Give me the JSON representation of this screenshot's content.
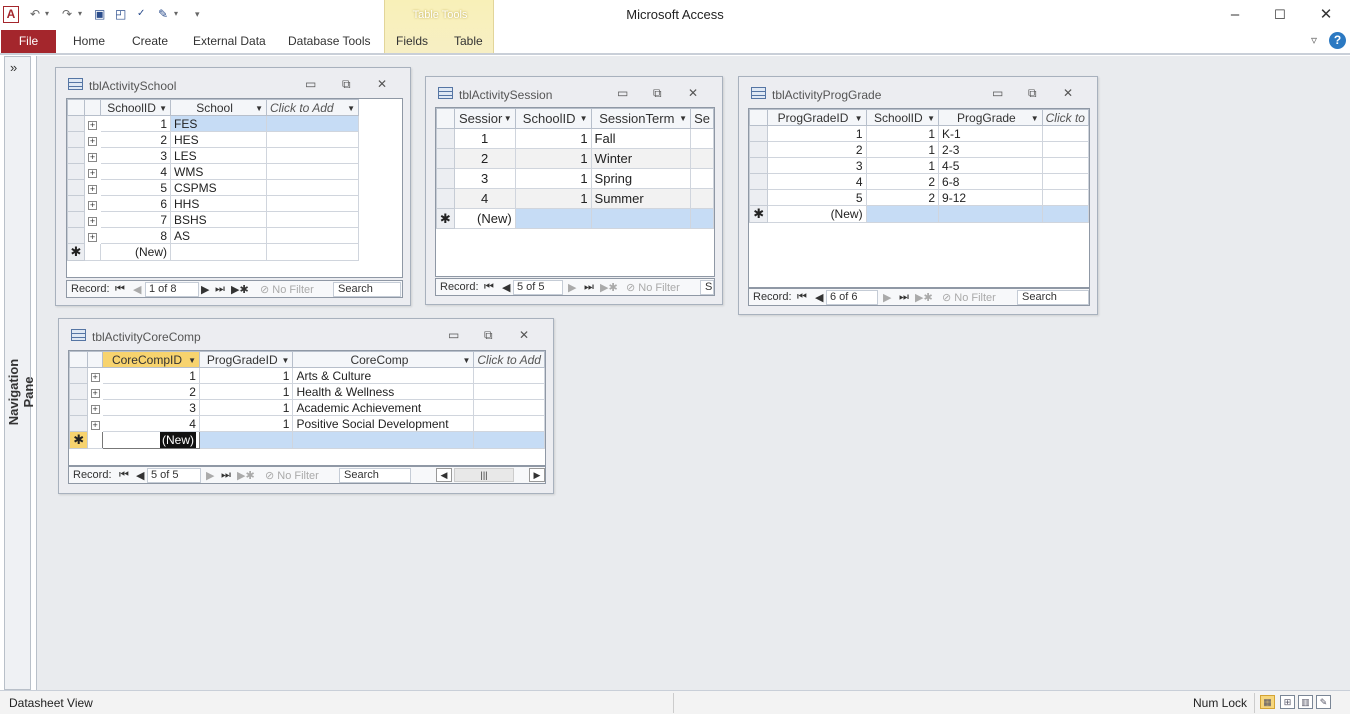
{
  "window_title": "Microsoft Access",
  "app_icon": "A",
  "contextual_tab": "Table Tools",
  "ribbon_tabs": [
    "File",
    "Home",
    "Create",
    "External Data",
    "Database Tools",
    "Fields",
    "Table"
  ],
  "nav_pane": {
    "label": "Navigation Pane",
    "toggle": "»"
  },
  "status": {
    "left": "Datasheet View",
    "numlock": "Num Lock"
  },
  "windows": {
    "school": {
      "title": "tblActivitySchool",
      "headers": [
        "SchoolID",
        "School",
        "Click to Add"
      ],
      "rows": [
        [
          "1",
          "FES"
        ],
        [
          "2",
          "HES"
        ],
        [
          "3",
          "LES"
        ],
        [
          "4",
          "WMS"
        ],
        [
          "5",
          "CSPMS"
        ],
        [
          "6",
          "HHS"
        ],
        [
          "7",
          "BSHS"
        ],
        [
          "8",
          "AS"
        ]
      ],
      "new_label": "(New)",
      "nav": {
        "record_label": "Record:",
        "position": "1 of 8",
        "filter": "No Filter",
        "search": "Search"
      }
    },
    "session": {
      "title": "tblActivitySession",
      "headers": [
        "Sessior",
        "SchoolID",
        "SessionTerm",
        "Se"
      ],
      "rows": [
        [
          "1",
          "1",
          "Fall"
        ],
        [
          "2",
          "1",
          "Winter"
        ],
        [
          "3",
          "1",
          "Spring"
        ],
        [
          "4",
          "1",
          "Summer"
        ]
      ],
      "new_label": "(New)",
      "nav": {
        "record_label": "Record:",
        "position": "5 of 5",
        "filter": "No Filter",
        "search": "S"
      }
    },
    "proggrade": {
      "title": "tblActivityProgGrade",
      "headers": [
        "ProgGradeID",
        "SchoolID",
        "ProgGrade",
        "Click to"
      ],
      "rows": [
        [
          "1",
          "1",
          "K-1"
        ],
        [
          "2",
          "1",
          "2-3"
        ],
        [
          "3",
          "1",
          "4-5"
        ],
        [
          "4",
          "2",
          "6-8"
        ],
        [
          "5",
          "2",
          "9-12"
        ]
      ],
      "new_label": "(New)",
      "nav": {
        "record_label": "Record:",
        "position": "6 of 6",
        "filter": "No Filter",
        "search": "Search"
      }
    },
    "corecomp": {
      "title": "tblActivityCoreComp",
      "headers": [
        "CoreCompID",
        "ProgGradeID",
        "CoreComp",
        "Click to Add"
      ],
      "rows": [
        [
          "1",
          "1",
          "Arts & Culture"
        ],
        [
          "2",
          "1",
          "Health & Wellness"
        ],
        [
          "3",
          "1",
          "Academic Achievement"
        ],
        [
          "4",
          "1",
          "Positive Social Development"
        ]
      ],
      "new_label": "(New)",
      "nav": {
        "record_label": "Record:",
        "position": "5 of 5",
        "filter": "No Filter",
        "search": "Search"
      }
    }
  }
}
